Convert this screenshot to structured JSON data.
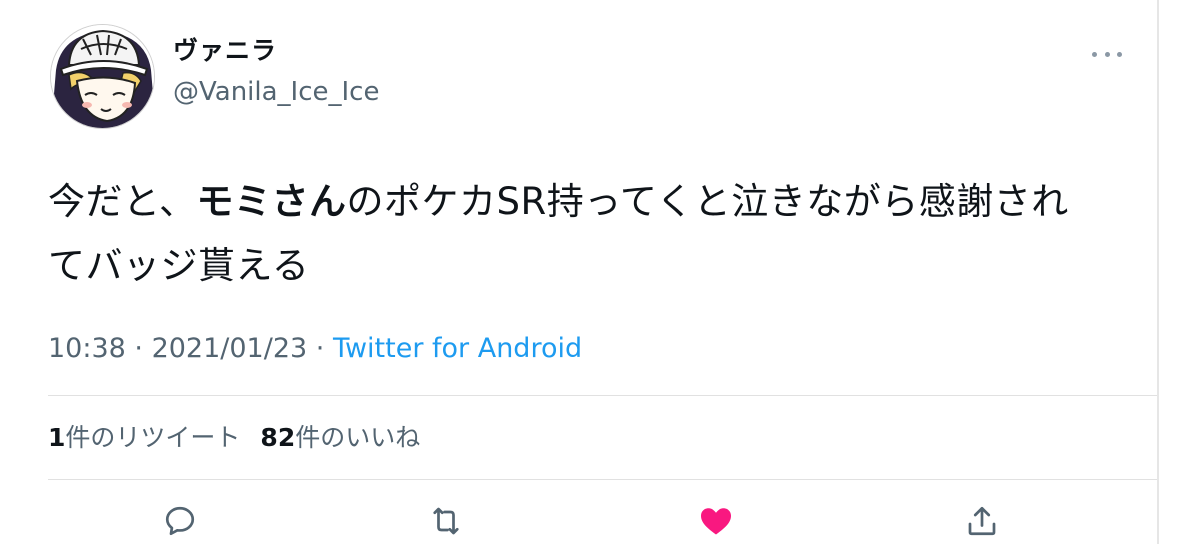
{
  "author": {
    "display_name": "ヴァニラ",
    "handle": "@Vanila_Ice_Ice"
  },
  "tweet": {
    "text_before": "今だと、",
    "text_bold": "モミさん",
    "text_after_line1": "のポケカSR持ってくと泣きながら感謝され",
    "text_line2": "てバッジ貰える"
  },
  "meta": {
    "time": "10:38",
    "separator": " · ",
    "date": "2021/01/23",
    "source": "Twitter for Android"
  },
  "stats": {
    "retweet_count": "1",
    "retweet_label": "件のリツイート",
    "like_count": "82",
    "like_label": "件のいいね"
  },
  "icons": {
    "more": "more-icon",
    "reply": "reply-icon",
    "retweet": "retweet-icon",
    "like": "heart-icon",
    "share": "share-icon"
  },
  "colors": {
    "link": "#1d9bf0",
    "secondary_text": "#536471",
    "like": "#f91880"
  }
}
